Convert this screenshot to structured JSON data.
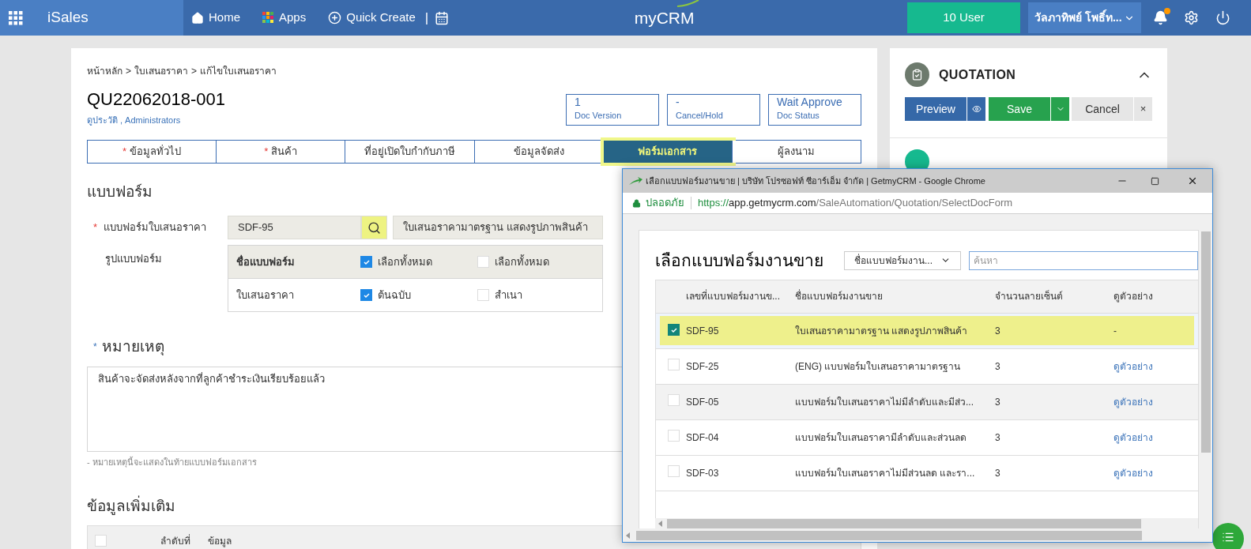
{
  "topbar": {
    "app_name": "iSales",
    "nav": [
      {
        "kind": "home",
        "label": "Home"
      },
      {
        "kind": "apps",
        "label": "Apps"
      },
      {
        "kind": "create",
        "label": "Quick Create"
      }
    ],
    "separator": "|",
    "logo": "myCRM",
    "user_count": "10 User",
    "user_name": "วัลภาทิพย์ โพธิ์ท...",
    "notification": true
  },
  "breadcrumb": [
    "หน้าหลัก",
    ">",
    "ใบเสนอราคา",
    ">",
    "แก้ไขใบเสนอราคา"
  ],
  "doc": {
    "number": "QU22062018-001",
    "history_link": "ดูประวัติ",
    "separator": ",",
    "owner": "Administrators"
  },
  "status_boxes": [
    {
      "value": "1",
      "label": "Doc Version"
    },
    {
      "value": "-",
      "label": "Cancel/Hold"
    },
    {
      "value": "Wait Approve",
      "label": "Doc Status"
    }
  ],
  "tabs": [
    {
      "label": "ข้อมูลทั่วไป",
      "mark": "*",
      "selected": false
    },
    {
      "label": "สินค้า",
      "mark": "*",
      "selected": false
    },
    {
      "label": "ที่อยู่เปิดใบกำกับภาษี",
      "selected": false
    },
    {
      "label": "ข้อมูลจัดส่ง",
      "selected": false
    },
    {
      "label": "ฟอร์มเอกสาร",
      "selected": true
    },
    {
      "label": "ผู้ลงนาม",
      "selected": false
    }
  ],
  "form_section": {
    "title": "แบบฟอร์ม",
    "template_label": "แบบฟอร์มใบเสนอราคา",
    "template_mark": "*",
    "template_code": "SDF-95",
    "template_name": "ใบเสนอราคามาตรฐาน แสดงรูปภาพสินค้า",
    "format_label": "รูปแบบฟอร์ม",
    "format_header": {
      "name": "ชื่อแบบฟอร์ม",
      "options": [
        {
          "label": "เลือกทั้งหมด",
          "checked": true
        },
        {
          "label": "เลือกทั้งหมด",
          "checked": false
        }
      ]
    },
    "format_rows": [
      {
        "name": "ใบเสนอราคา",
        "options": [
          {
            "label": "ต้นฉบับ",
            "checked": true
          },
          {
            "label": "สำเนา",
            "checked": false
          }
        ]
      }
    ]
  },
  "remark": {
    "mark": "*",
    "title": "หมายเหตุ",
    "value": "สินค้าจะจัดส่งหลังจากที่ลูกค้าชำระเงินเรียบร้อยแล้ว",
    "hint": "- หมายเหตุนี้จะแสดงในท้ายแบบฟอร์มเอกสาร"
  },
  "extra": {
    "title": "ข้อมูลเพิ่มเติม",
    "select_all": false,
    "columns": [
      "ลำดับที่",
      "ข้อมูล"
    ]
  },
  "side": {
    "title": "QUOTATION",
    "expanded": true,
    "buttons": {
      "preview": "Preview",
      "save": "Save",
      "cancel": "Cancel",
      "close": "×"
    }
  },
  "popup": {
    "title": "เลือกแบบฟอร์มงานขาย | บริษัท โปรซอฟท์ ซีอาร์เอ็ม จำกัด | GetmyCRM - Google Chrome",
    "secure_label": "ปลอดภัย",
    "url_scheme": "https://",
    "url_host": "app.getmycrm.com",
    "url_path": "/SaleAutomation/Quotation/SelectDocForm",
    "heading": "เลือกแบบฟอร์มงานขาย",
    "filter": "ชื่อแบบฟอร์มงาน...",
    "search_placeholder": "ค้นหา",
    "columns": [
      "เลขที่แบบฟอร์มงานข...",
      "ชื่อแบบฟอร์มงานขาย",
      "จำนวนลายเซ็นต์",
      "ดูตัวอย่าง"
    ],
    "rows": [
      {
        "code": "SDF-95",
        "name": "ใบเสนอราคามาตรฐาน แสดงรูปภาพสินค้า",
        "signatures": "3",
        "preview": "-",
        "selected": true,
        "hovered": false
      },
      {
        "code": "SDF-25",
        "name": "(ENG) แบบฟอร์มใบเสนอราคามาตรฐาน",
        "signatures": "3",
        "preview": "ดูตัวอย่าง",
        "selected": false,
        "hovered": false
      },
      {
        "code": "SDF-05",
        "name": "แบบฟอร์มใบเสนอราคาไม่มีลำดับและมีส่ว...",
        "signatures": "3",
        "preview": "ดูตัวอย่าง",
        "selected": false,
        "hovered": true
      },
      {
        "code": "SDF-04",
        "name": "แบบฟอร์มใบเสนอราคามีลำดับและส่วนลด",
        "signatures": "3",
        "preview": "ดูตัวอย่าง",
        "selected": false,
        "hovered": false
      },
      {
        "code": "SDF-03",
        "name": "แบบฟอร์มใบเสนอราคาไม่มีส่วนลด และรา...",
        "signatures": "3",
        "preview": "ดูตัวอย่าง",
        "selected": false,
        "hovered": false
      }
    ]
  }
}
